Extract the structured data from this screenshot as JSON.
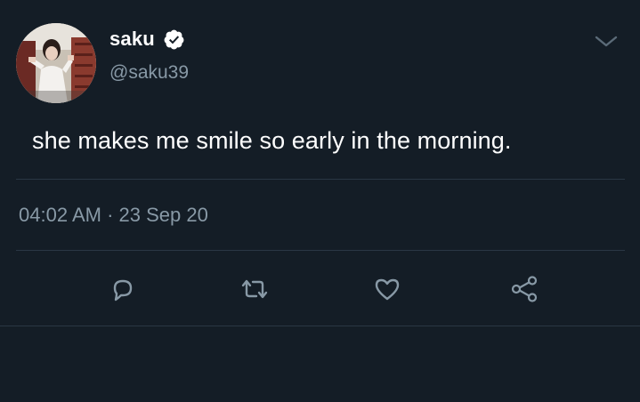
{
  "tweet": {
    "display_name": "saku",
    "handle": "@saku39",
    "text": "she makes me smile so early in the morning.",
    "time": "04:02 AM",
    "separator": "·",
    "date": "23 Sep 20",
    "verified": true
  },
  "icons": {
    "avatar": "avatar-photo",
    "verified": "verified-badge-icon",
    "menu": "chevron-down-icon",
    "reply": "reply-icon",
    "retweet": "retweet-icon",
    "like": "heart-icon",
    "share": "share-icon"
  },
  "colors": {
    "background": "#141d26",
    "primary_text": "#ffffff",
    "secondary_text": "#8899a6",
    "divider": "#2a3744"
  }
}
